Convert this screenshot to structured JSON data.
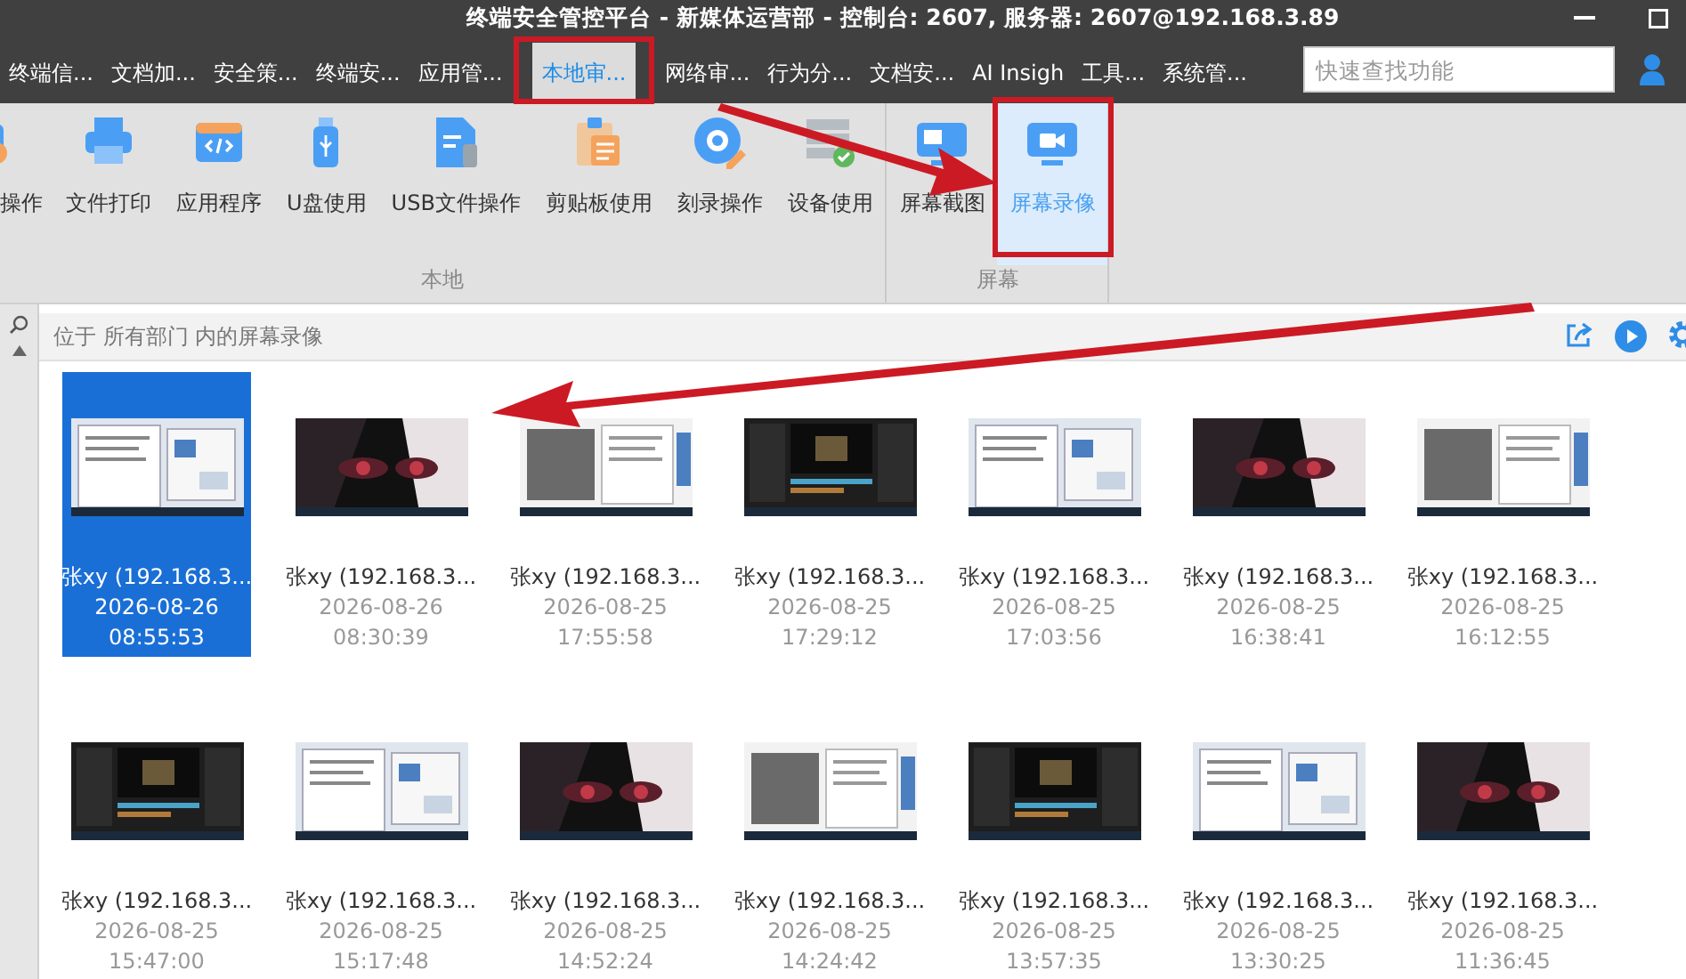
{
  "window": {
    "title": "终端安全管控平台 - 新媒体运营部 - 控制台: 2607, 服务器: 2607@192.168.3.89"
  },
  "menu_tabs": [
    {
      "label": "终端信...",
      "selected": false
    },
    {
      "label": "文档加...",
      "selected": false
    },
    {
      "label": "安全策...",
      "selected": false
    },
    {
      "label": "终端安...",
      "selected": false
    },
    {
      "label": "应用管...",
      "selected": false
    },
    {
      "label": "本地审...",
      "selected": true
    },
    {
      "label": "网络审...",
      "selected": false
    },
    {
      "label": "行为分...",
      "selected": false
    },
    {
      "label": "文档安...",
      "selected": false
    },
    {
      "label": "AI Insigh",
      "selected": false
    },
    {
      "label": "工具...",
      "selected": false
    },
    {
      "label": "系统管...",
      "selected": false
    }
  ],
  "search": {
    "placeholder": "快速查找功能"
  },
  "ribbon": {
    "groups": [
      {
        "label": "本地",
        "items": [
          {
            "label": "操作",
            "selected": false
          },
          {
            "label": "文件打印",
            "selected": false
          },
          {
            "label": "应用程序",
            "selected": false
          },
          {
            "label": "U盘使用",
            "selected": false
          },
          {
            "label": "USB文件操作",
            "selected": false
          },
          {
            "label": "剪贴板使用",
            "selected": false
          },
          {
            "label": "刻录操作",
            "selected": false
          },
          {
            "label": "设备使用",
            "selected": false
          }
        ]
      },
      {
        "label": "屏幕",
        "items": [
          {
            "label": "屏幕截图",
            "selected": false
          },
          {
            "label": "屏幕录像",
            "selected": true
          }
        ]
      }
    ]
  },
  "location": "位于 所有部门 内的屏幕录像",
  "recordings": [
    {
      "user": "张xy (192.168.3...",
      "date": "2026-08-26",
      "time": "08:55:53",
      "selected": true
    },
    {
      "user": "张xy (192.168.3...",
      "date": "2026-08-26",
      "time": "08:30:39",
      "selected": false
    },
    {
      "user": "张xy (192.168.3...",
      "date": "2026-08-25",
      "time": "17:55:58",
      "selected": false
    },
    {
      "user": "张xy (192.168.3...",
      "date": "2026-08-25",
      "time": "17:29:12",
      "selected": false
    },
    {
      "user": "张xy (192.168.3...",
      "date": "2026-08-25",
      "time": "17:03:56",
      "selected": false
    },
    {
      "user": "张xy (192.168.3...",
      "date": "2026-08-25",
      "time": "16:38:41",
      "selected": false
    },
    {
      "user": "张xy (192.168.3...",
      "date": "2026-08-25",
      "time": "16:12:55",
      "selected": false
    },
    {
      "user": "张xy (192.168.3...",
      "date": "2026-08-25",
      "time": "15:47:00",
      "selected": false
    },
    {
      "user": "张xy (192.168.3...",
      "date": "2026-08-25",
      "time": "15:17:48",
      "selected": false
    },
    {
      "user": "张xy (192.168.3...",
      "date": "2026-08-25",
      "time": "14:52:24",
      "selected": false
    },
    {
      "user": "张xy (192.168.3...",
      "date": "2026-08-25",
      "time": "14:24:42",
      "selected": false
    },
    {
      "user": "张xy (192.168.3...",
      "date": "2026-08-25",
      "time": "13:57:35",
      "selected": false
    },
    {
      "user": "张xy (192.168.3...",
      "date": "2026-08-25",
      "time": "13:30:25",
      "selected": false
    },
    {
      "user": "张xy (192.168.3...",
      "date": "2026-08-25",
      "time": "11:36:45",
      "selected": false
    }
  ]
}
